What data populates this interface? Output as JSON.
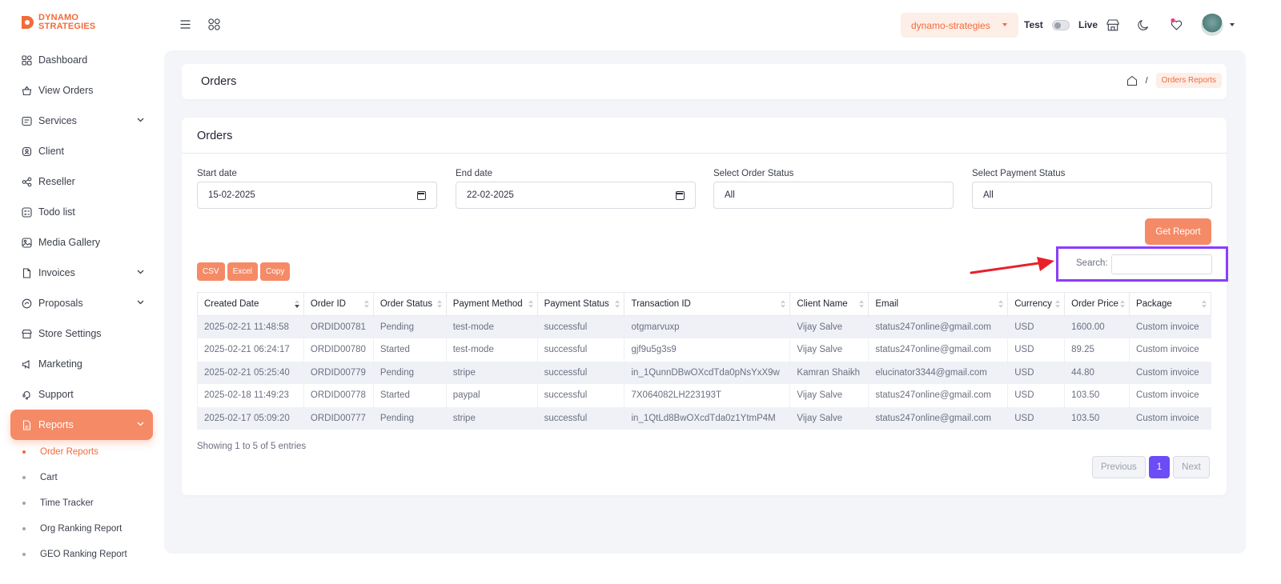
{
  "brand": {
    "line1": "DYNAMO",
    "line2": "STRATEGIES",
    "color": "#f26b3a"
  },
  "sidebar": {
    "items": [
      {
        "label": "Dashboard",
        "icon": "dashboard-icon"
      },
      {
        "label": "View Orders",
        "icon": "basket-icon"
      },
      {
        "label": "Services",
        "icon": "services-icon",
        "expandable": true
      },
      {
        "label": "Client",
        "icon": "client-icon"
      },
      {
        "label": "Reseller",
        "icon": "reseller-icon"
      },
      {
        "label": "Todo list",
        "icon": "todo-icon"
      },
      {
        "label": "Media Gallery",
        "icon": "gallery-icon"
      },
      {
        "label": "Invoices",
        "icon": "invoice-icon",
        "expandable": true
      },
      {
        "label": "Proposals",
        "icon": "proposal-icon",
        "expandable": true
      },
      {
        "label": "Store Settings",
        "icon": "store-icon"
      },
      {
        "label": "Marketing",
        "icon": "megaphone-icon"
      },
      {
        "label": "Support",
        "icon": "support-icon"
      },
      {
        "label": "Reports",
        "icon": "report-icon",
        "expandable": true,
        "active": true
      }
    ],
    "subitems": [
      "Order Reports",
      "Cart",
      "Time Tracker",
      "Org Ranking Report",
      "GEO Ranking Report"
    ]
  },
  "topbar": {
    "org": "dynamo-strategies",
    "test_label": "Test",
    "live_label": "Live"
  },
  "page": {
    "title": "Orders",
    "breadcrumb_sep": "/",
    "breadcrumb_current": "Orders Reports"
  },
  "filters": {
    "start_label": "Start date",
    "start_value": "15-02-2025",
    "end_label": "End date",
    "end_value": "22-02-2025",
    "order_status_label": "Select Order Status",
    "order_status_value": "All",
    "payment_status_label": "Select Payment Status",
    "payment_status_value": "All",
    "get_report": "Get Report"
  },
  "orders": {
    "title": "Orders",
    "export": [
      "CSV",
      "Excel",
      "Copy"
    ],
    "search_label": "Search:",
    "columns": [
      "Created Date",
      "Order ID",
      "Order Status",
      "Payment Method",
      "Payment Status",
      "Transaction ID",
      "Client Name",
      "Email",
      "Currency",
      "Order Price",
      "Package"
    ],
    "rows": [
      [
        "2025-02-21 11:48:58",
        "ORDID00781",
        "Pending",
        "test-mode",
        "successful",
        "otgmarvuxp",
        "Vijay Salve",
        "status247online@gmail.com",
        "USD",
        "1600.00",
        "Custom invoice"
      ],
      [
        "2025-02-21 06:24:17",
        "ORDID00780",
        "Started",
        "test-mode",
        "successful",
        "gjf9u5g3s9",
        "Vijay Salve",
        "status247online@gmail.com",
        "USD",
        "89.25",
        "Custom invoice"
      ],
      [
        "2025-02-21 05:25:40",
        "ORDID00779",
        "Pending",
        "stripe",
        "successful",
        "in_1QunnDBwOXcdTda0pNsYxX9w",
        "Kamran Shaikh",
        "elucinator3344@gmail.com",
        "USD",
        "44.80",
        "Custom invoice"
      ],
      [
        "2025-02-18 11:49:23",
        "ORDID00778",
        "Started",
        "paypal",
        "successful",
        "7X064082LH223193T",
        "Vijay Salve",
        "status247online@gmail.com",
        "USD",
        "103.50",
        "Custom invoice"
      ],
      [
        "2025-02-17 05:09:20",
        "ORDID00777",
        "Pending",
        "stripe",
        "successful",
        "in_1QtLd8BwOXcdTda0z1YtmP4M",
        "Vijay Salve",
        "status247online@gmail.com",
        "USD",
        "103.50",
        "Custom invoice"
      ]
    ],
    "showing": "Showing 1 to 5 of 5 entries",
    "pager": {
      "previous": "Previous",
      "current": "1",
      "next": "Next"
    }
  },
  "colors": {
    "accent": "#f58a67",
    "pager_active": "#6c4cf5",
    "highlight": "#8b3dff",
    "arrow": "#e8202a"
  }
}
